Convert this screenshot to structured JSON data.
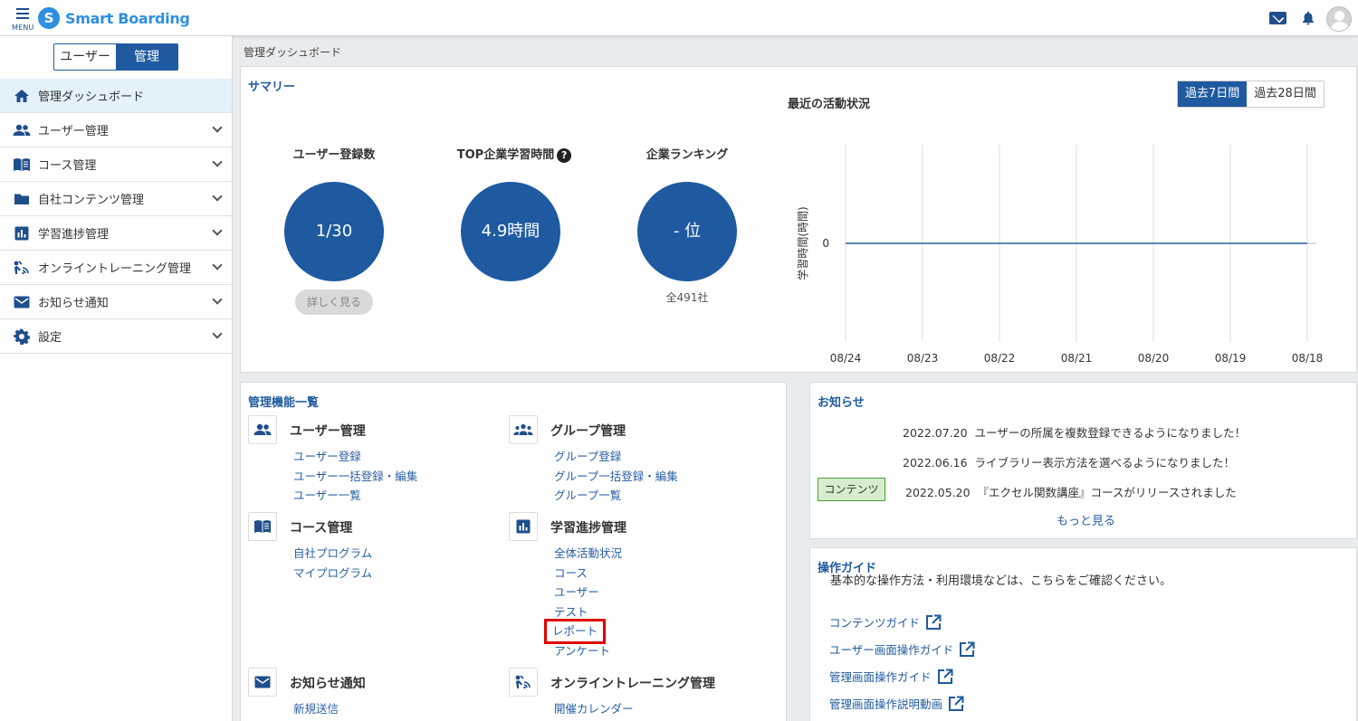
{
  "header": {
    "menu_label": "MENU",
    "logo_text": "Smart Boarding",
    "logo_mark": "S"
  },
  "sidebar": {
    "toggle": {
      "user": "ユーザー",
      "admin": "管理"
    },
    "items": [
      {
        "label": "管理ダッシュボード",
        "icon": "home-icon"
      },
      {
        "label": "ユーザー管理",
        "icon": "users-icon"
      },
      {
        "label": "コース管理",
        "icon": "book-icon"
      },
      {
        "label": "自社コンテンツ管理",
        "icon": "folder-icon"
      },
      {
        "label": "学習進捗管理",
        "icon": "bar-chart-icon"
      },
      {
        "label": "オンライントレーニング管理",
        "icon": "online-training-icon"
      },
      {
        "label": "お知らせ通知",
        "icon": "mail-icon"
      },
      {
        "label": "設定",
        "icon": "gear-icon"
      }
    ]
  },
  "breadcrumb": "管理ダッシュボード",
  "summary": {
    "title": "サマリー",
    "stats": [
      {
        "label": "ユーザー登録数",
        "value": "1/30",
        "action": "詳しく見る"
      },
      {
        "label": "TOP企業学習時間",
        "value": "4.9時間",
        "help": "?"
      },
      {
        "label": "企業ランキング",
        "value": "- 位",
        "sub": "全491社"
      }
    ]
  },
  "chart_data": {
    "type": "line",
    "title": "最近の活動状況",
    "ylabel": "学習時間(時間)",
    "xlabel": "",
    "categories": [
      "08/24",
      "08/23",
      "08/22",
      "08/21",
      "08/20",
      "08/19",
      "08/18"
    ],
    "series": [
      {
        "values": [
          0,
          0,
          0,
          0,
          0,
          0,
          0
        ]
      }
    ],
    "yticks": [
      "0"
    ],
    "grid": "vertical",
    "periods": [
      "過去7日間",
      "過去28日間"
    ],
    "active_period": "過去7日間",
    "line_color": "#2c5aa0"
  },
  "functions": {
    "title": "管理機能一覧",
    "groups": [
      {
        "title": "ユーザー管理",
        "icon": "users-icon",
        "links": [
          "ユーザー登録",
          "ユーザー一括登録・編集",
          "ユーザー一覧"
        ]
      },
      {
        "title": "グループ管理",
        "icon": "group-icon",
        "links": [
          "グループ登録",
          "グループ一括登録・編集",
          "グループ一覧"
        ]
      },
      {
        "title": "コース管理",
        "icon": "book-icon",
        "links": [
          "自社プログラム",
          "マイプログラム"
        ]
      },
      {
        "title": "学習進捗管理",
        "icon": "bar-chart-icon",
        "links": [
          "全体活動状況",
          "コース",
          "ユーザー",
          "テスト",
          "レポート",
          "アンケート"
        ]
      },
      {
        "title": "お知らせ通知",
        "icon": "mail-icon",
        "links": [
          "新規送信"
        ]
      },
      {
        "title": "オンライントレーニング管理",
        "icon": "online-training-icon",
        "links": [
          "開催カレンダー"
        ]
      }
    ]
  },
  "news": {
    "title": "お知らせ",
    "items": [
      {
        "date": "2022.07.20",
        "text": "ユーザーの所属を複数登録できるようになりました！",
        "tag": ""
      },
      {
        "date": "2022.06.16",
        "text": "ライブラリー表示方法を選べるようになりました！",
        "tag": ""
      },
      {
        "date": "2022.05.20",
        "text": "『エクセル関数講座』コースがリリースされました",
        "tag": "コンテンツ"
      }
    ],
    "more": "もっと見る"
  },
  "guide": {
    "title": "操作ガイド",
    "desc": "基本的な操作方法・利用環境などは、こちらをご確認ください。",
    "links": [
      "コンテンツガイド",
      "ユーザー画面操作ガイド",
      "管理画面操作ガイド",
      "管理画面操作説明動画"
    ]
  },
  "colors": {
    "primary": "#1f5aa0",
    "accent": "#2e8fe0",
    "highlight": "#e00000"
  }
}
